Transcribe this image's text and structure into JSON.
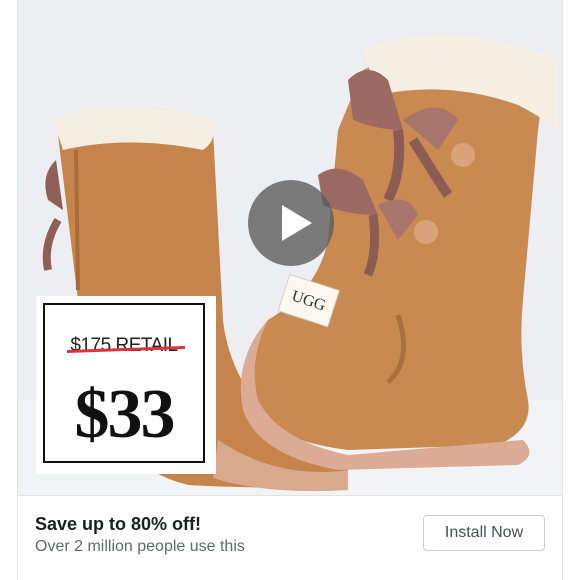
{
  "ad": {
    "media": {
      "image_description_icon": "boots-photo",
      "play_icon": "play-icon"
    },
    "price_tag": {
      "old_price": "$175 RETAIL",
      "new_price": "$33"
    },
    "boot_label": "UGG",
    "headline": "Save up to 80% off!",
    "subline": "Over 2 million people use this",
    "cta_label": "Install Now"
  },
  "colors": {
    "strike": "#d9343a",
    "boot": "#c98a52",
    "bow": "#9c6a62"
  }
}
